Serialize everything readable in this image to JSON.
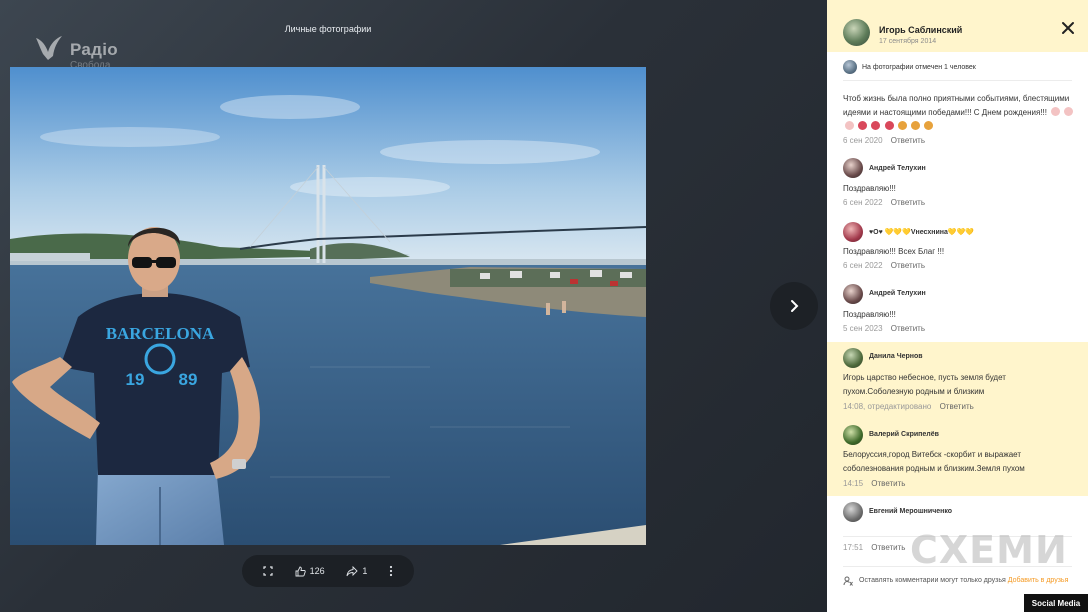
{
  "viewer": {
    "title": "Личные фотографии",
    "logo": {
      "name": "Радіо",
      "sub": "Свобода"
    },
    "shirt_text": {
      "line1": "BARCELONA",
      "line2": "19",
      "line3": "89"
    },
    "actions": {
      "likes": "126",
      "shares": "1"
    },
    "icons": [
      "expand-icon",
      "like-icon",
      "share-icon",
      "more-icon",
      "chevron-right-icon"
    ]
  },
  "panel": {
    "owner": {
      "name": "Игорь Саблинский",
      "date": "17 сентября 2014"
    },
    "tagged": "На фотографии отмечен 1 человек",
    "caption": {
      "text": "Чтоб жизнь была полно приятными событиями, блестящими идеями и настоящими победами!!! С Днем рождения!!!",
      "time": "6 сен 2020",
      "reply": "Ответить"
    },
    "comments": [
      {
        "name": "Андрей Телухин",
        "text": "Поздравляю!!!",
        "time": "6 сен 2022",
        "reply": "Ответить",
        "highlight": false
      },
      {
        "name": "♥О♥ 💛💛💛Vнесхнина💛💛💛",
        "text": "Поздравляю!!! Всех Благ !!!",
        "time": "6 сен 2022",
        "reply": "Ответить",
        "highlight": false
      },
      {
        "name": "Андрей Телухин",
        "text": "Поздравляю!!!",
        "time": "5 сен 2023",
        "reply": "Ответить",
        "highlight": false
      },
      {
        "name": "Данила Чернов",
        "text": "Игорь царство небесное, пусть земля будет пухом.Соболезную родным и близким",
        "time": "14:08, отредактировано",
        "reply": "Ответить",
        "highlight": true
      },
      {
        "name": "Валерий Скрипелёв",
        "text": "Белоруссия,город Витебск -скорбит и выражает соболезнования родным и близким.Земля пухом",
        "time": "14:15",
        "reply": "Ответить",
        "highlight": true
      },
      {
        "name": "Евгений Мерошниченко",
        "text": "",
        "time": "17:51",
        "reply": "Ответить",
        "highlight": false
      }
    ],
    "footer": {
      "text": "Оставлять комментарии могут только друзья",
      "link": "Добавить в друзья"
    }
  },
  "overlay": {
    "watermark": "СХЕМИ",
    "badge": "Social Media"
  },
  "colors": {
    "highlight": "#fff5cc",
    "viewer_bg": "#2a3038",
    "accent": "#f59a23"
  }
}
